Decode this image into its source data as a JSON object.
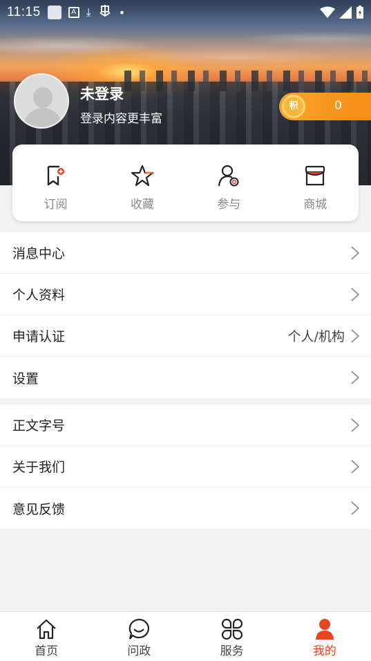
{
  "status_bar": {
    "time": "11:15",
    "dot": "•"
  },
  "profile": {
    "name": "未登录",
    "subtitle": "登录内容更丰富"
  },
  "points": {
    "badge": "积",
    "value": "0"
  },
  "quick_actions": [
    {
      "label": "订阅",
      "icon": "subscribe-icon"
    },
    {
      "label": "收藏",
      "icon": "star-icon"
    },
    {
      "label": "参与",
      "icon": "participate-icon"
    },
    {
      "label": "商城",
      "icon": "shop-icon"
    }
  ],
  "menu_group_1": [
    {
      "label": "消息中心",
      "value": ""
    },
    {
      "label": "个人资料",
      "value": ""
    },
    {
      "label": "申请认证",
      "value": "个人/机构"
    },
    {
      "label": "设置",
      "value": ""
    }
  ],
  "menu_group_2": [
    {
      "label": "正文字号",
      "value": ""
    },
    {
      "label": "关于我们",
      "value": ""
    },
    {
      "label": "意见反馈",
      "value": ""
    }
  ],
  "bottom_nav": [
    {
      "label": "首页",
      "icon": "home-icon"
    },
    {
      "label": "问政",
      "icon": "chat-icon"
    },
    {
      "label": "服务",
      "icon": "services-icon"
    },
    {
      "label": "我的",
      "icon": "profile-icon",
      "active": true
    }
  ],
  "colors": {
    "accent": "#e8461e",
    "points_orange": "#f68c17",
    "star_orange": "#e8733a"
  }
}
